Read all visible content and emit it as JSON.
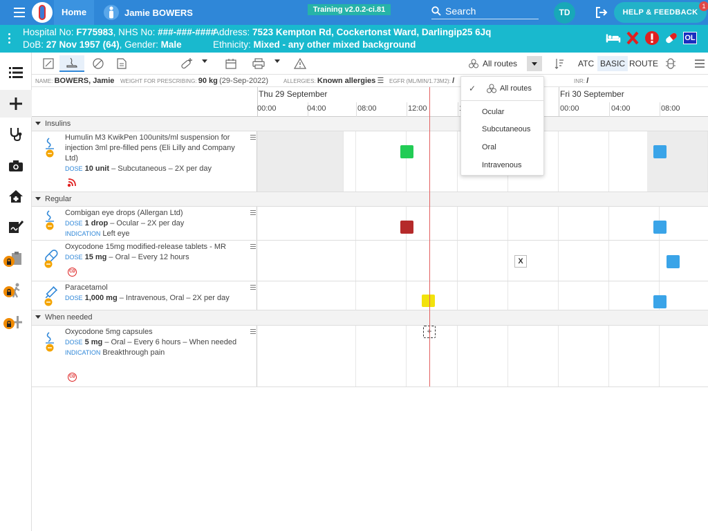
{
  "topbar": {
    "home_label": "Home",
    "patient_name": "Jamie BOWERS",
    "training_label": "Training v2.0.2-ci.81",
    "search_placeholder": "Search",
    "user_initials": "TD",
    "help_label": "HELP & FEEDBACK",
    "help_badge": "1",
    "colors": {
      "bar": "#2f87d8",
      "banner": "#19b9ce",
      "help": "#22b2c8",
      "training": "#26b3a8"
    }
  },
  "banner": {
    "hospital_label": "Hospital No:",
    "hospital_no": "F775983",
    "nhs_label": "NHS No:",
    "nhs_no": "###-###-####",
    "address_label": "Address:",
    "address": "7523 Kempton Rd, Cockertonst Ward, Darlingip25 6Jq",
    "dob_label": "DoB:",
    "dob": "27 Nov 1957 (64)",
    "gender_label": "Gender:",
    "gender": "Male",
    "ethnicity_label": "Ethnicity:",
    "ethnicity": "Mixed - any other mixed background",
    "icons": [
      "bed-icon",
      "red-x-icon",
      "alert-icon",
      "capsule-icon"
    ],
    "ol_badge": "OL"
  },
  "leftnav": {
    "items": [
      "list-icon",
      "plus-icon",
      "stethoscope-icon",
      "camera-icon",
      "home-medical-icon",
      "form-signature-icon",
      "clipboard-icon",
      "walking-icon",
      "add-icon"
    ]
  },
  "toolbar": {
    "routes_label": "All routes",
    "atc_label": "ATC",
    "basic_label": "BASIC",
    "route_label": "ROUTE"
  },
  "info": {
    "name_label": "Name:",
    "name": "BOWERS, Jamie",
    "weight_label": "Weight for prescribing:",
    "weight": "90 kg",
    "weight_date": "(29-Sep-2022)",
    "allergies_label": "Allergies:",
    "allergies": "Known allergies",
    "egfr_label": "eGFR (mL/min/1.73m2):",
    "egfr": "/",
    "inr_label": "INR:",
    "inr": "/"
  },
  "timeline": {
    "day1": "Thu 29 September",
    "day2": "Fri 30 September",
    "hours": [
      "00:00",
      "04:00",
      "08:00",
      "12:00",
      "1",
      "",
      "00:00",
      "04:00",
      "08:00"
    ]
  },
  "sections": {
    "insulins": "Insulins",
    "regular": "Regular",
    "when_needed": "When needed"
  },
  "meds": [
    {
      "name": "Humulin M3 KwikPen 100units/ml suspension for injection 3ml pre-filled pens (Eli Lilly and Company Ltd)",
      "dose_label": "DOSE",
      "dose": "10 unit",
      "detail": " – Subcutaneous – 2X per day"
    },
    {
      "name": "Combigan eye drops (Allergan Ltd)",
      "dose_label": "DOSE",
      "dose": "1 drop",
      "detail": " – Ocular – 2X per day",
      "indication_label": "INDICATION",
      "indication": "Left eye"
    },
    {
      "name": "Oxycodone 15mg modified-release tablets - MR",
      "dose_label": "DOSE",
      "dose": "15 mg",
      "detail": " – Oral – Every 12 hours",
      "badge": "CD",
      "xbox": "X"
    },
    {
      "name": "Paracetamol",
      "dose_label": "DOSE",
      "dose": "1,000 mg",
      "detail": " – Intravenous, Oral – 2X per day"
    },
    {
      "name": "Oxycodone 5mg capsules",
      "dose_label": "DOSE",
      "dose": "5 mg",
      "detail": " – Oral – Every 6 hours – When needed",
      "indication_label": "INDICATION",
      "indication": "Breakthrough pain",
      "badge": "CD",
      "plus": "+"
    }
  ],
  "status_colors": {
    "given": "#22cc55",
    "missed": "#b52a2a",
    "due": "#3aa4e8",
    "pending": "#f2e20c",
    "now_line": "#e36060"
  },
  "dropdown": {
    "items": [
      "All routes",
      "Ocular",
      "Subcutaneous",
      "Oral",
      "Intravenous"
    ],
    "selected": "All routes",
    "check": "✓"
  }
}
